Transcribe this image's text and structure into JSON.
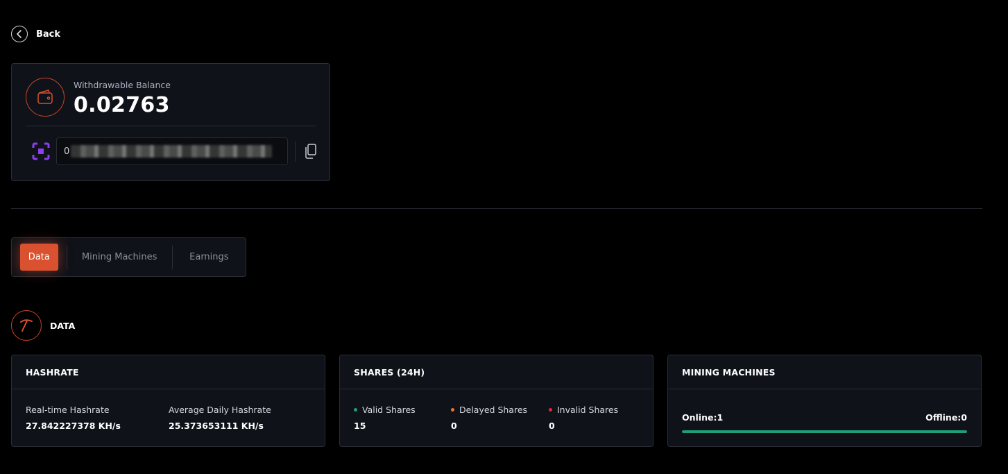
{
  "back": {
    "label": "Back"
  },
  "balance": {
    "label": "Withdrawable Balance",
    "value": "0.02763",
    "address_prefix": "0"
  },
  "tabs": [
    {
      "label": "Data",
      "active": true
    },
    {
      "label": "Mining Machines",
      "active": false
    },
    {
      "label": "Earnings",
      "active": false
    }
  ],
  "section": {
    "title": "DATA"
  },
  "hashrate": {
    "title": "HASHRATE",
    "realtime_label": "Real-time Hashrate",
    "realtime_value": "27.842227378 KH/s",
    "average_label": "Average Daily Hashrate",
    "average_value": "25.373653111 KH/s"
  },
  "shares": {
    "title": "SHARES (24H)",
    "valid_label": "Valid Shares",
    "valid_value": "15",
    "delayed_label": "Delayed Shares",
    "delayed_value": "0",
    "invalid_label": "Invalid Shares",
    "invalid_value": "0"
  },
  "machines": {
    "title": "MINING MACHINES",
    "online_label": "Online:1",
    "offline_label": "Offline:0",
    "online_fraction": 1.0
  },
  "colors": {
    "accent": "#d9512f",
    "valid": "#1f9e77",
    "delayed": "#e8742c",
    "invalid": "#e0283a",
    "address_icon": "#8b3ff0"
  },
  "icons": {
    "back": "chevron-left-icon",
    "wallet": "wallet-icon",
    "address": "scan-icon",
    "copy": "copy-icon",
    "data": "pickaxe-icon"
  }
}
